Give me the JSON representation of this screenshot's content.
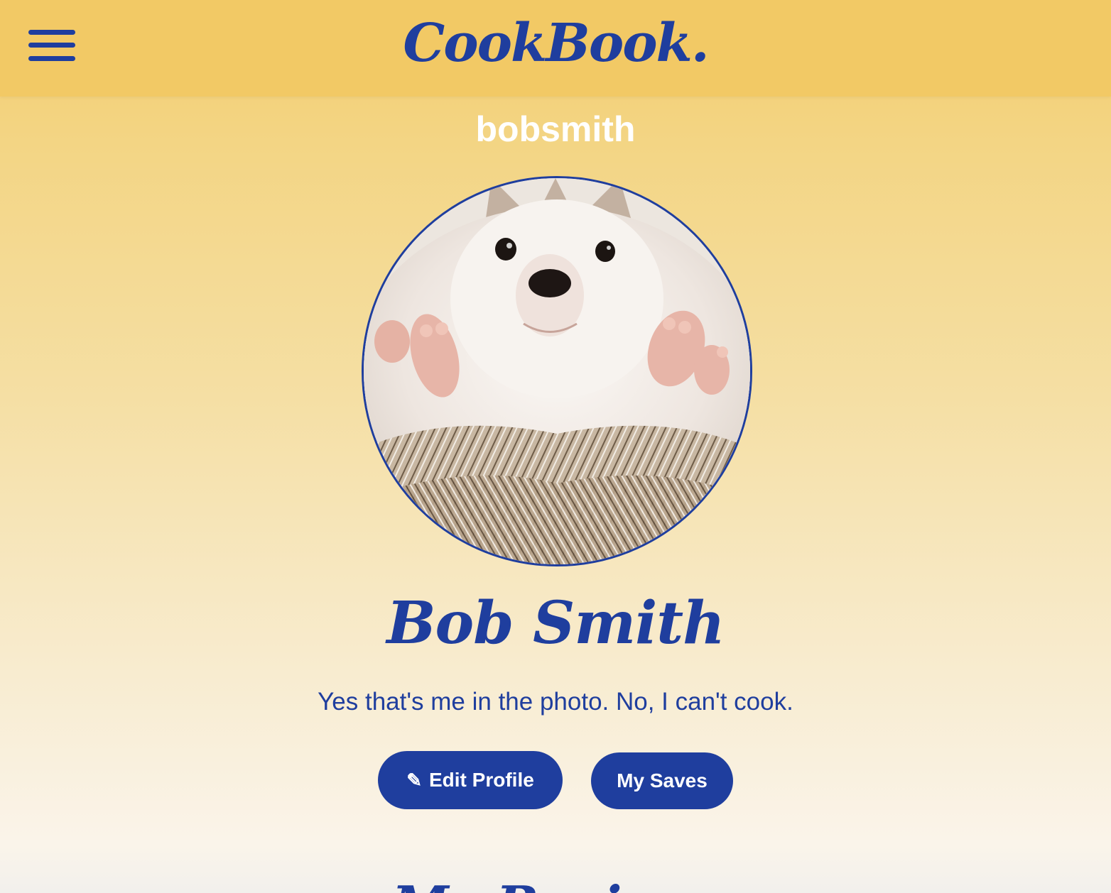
{
  "header": {
    "brand": "CookBook.",
    "menu_icon": "hamburger-menu-icon"
  },
  "profile": {
    "username": "bobsmith",
    "avatar_alt": "hedgehog",
    "full_name": "Bob Smith",
    "bio": "Yes that's me in the photo. No, I can't cook."
  },
  "actions": {
    "edit_icon": "✎",
    "edit_label": "Edit Profile",
    "saves_label": "My Saves"
  },
  "sections": {
    "recipes_title": "My Recipes"
  },
  "colors": {
    "accent": "#1f3e9e",
    "header_bg": "#f2c965",
    "text_light": "#ffffff"
  }
}
